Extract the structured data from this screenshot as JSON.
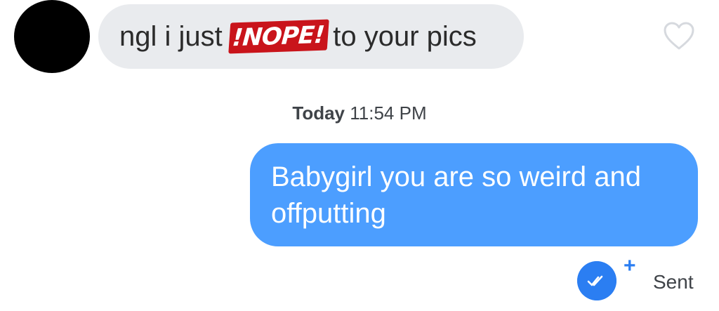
{
  "conversation": {
    "incoming_message": {
      "before": "ngl i just",
      "censored_word": "!NOPE!",
      "after": "to your pics"
    },
    "timestamp": {
      "day": "Today",
      "time": "11:54 PM"
    },
    "outgoing_message": {
      "text": "Babygirl you are so weird and offputting"
    },
    "status": {
      "label": "Sent",
      "plus": "+"
    }
  },
  "colors": {
    "incoming_bubble": "#e9ebee",
    "outgoing_bubble": "#4c9eff",
    "censor_sticker": "#c9141b",
    "read_receipt": "#2b7ef2"
  },
  "icons": [
    "avatar",
    "heart-icon",
    "double-check-icon",
    "plus-icon"
  ]
}
